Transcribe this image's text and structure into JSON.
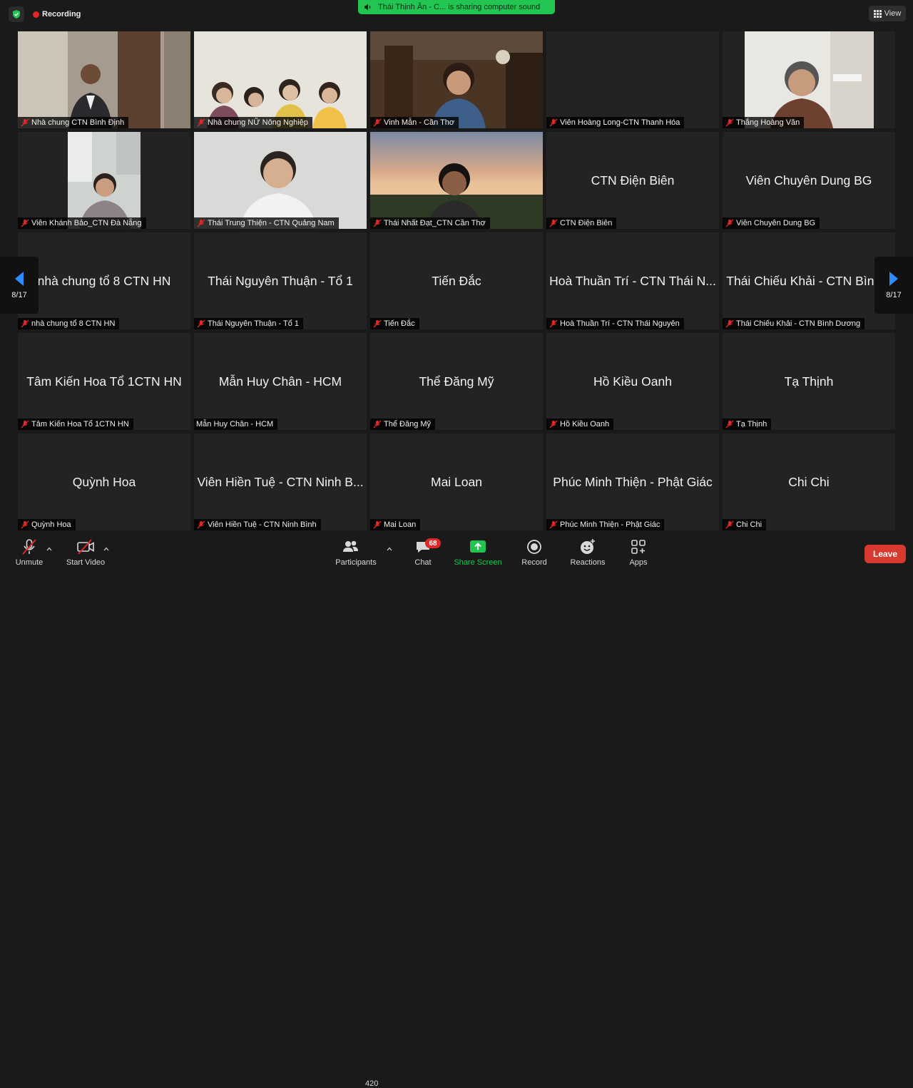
{
  "top": {
    "recording_label": "Recording",
    "share_banner": "Thái Thịnh Ân - C... is sharing computer sound",
    "view_label": "View"
  },
  "pager": {
    "left_text": "8/17",
    "right_text": "8/17"
  },
  "tiles": [
    {
      "name": "Nhà chung CTN Bình Định",
      "big": ""
    },
    {
      "name": "Nhà chung NỮ Nông Nghiệp",
      "big": ""
    },
    {
      "name": "Vinh Mẫn - Cần Thơ",
      "big": ""
    },
    {
      "name": "Viên Hoàng Long-CTN Thanh Hóa",
      "big": ""
    },
    {
      "name": "Thắng Hoàng Văn",
      "big": ""
    },
    {
      "name": "Viên Khánh Bảo_CTN Đà Nẵng",
      "big": ""
    },
    {
      "name": "Thái Trung Thiện - CTN Quảng Nam",
      "big": ""
    },
    {
      "name": "Thái Nhất Đạt_CTN Cần Thơ",
      "big": ""
    },
    {
      "name": "CTN Điện Biên",
      "big": "CTN Điện Biên"
    },
    {
      "name": "Viên Chuyên Dung BG",
      "big": "Viên Chuyên Dung BG"
    },
    {
      "name": "nhà chung tổ 8 CTN HN",
      "big": "nhà chung tổ 8 CTN HN"
    },
    {
      "name": "Thái Nguyên Thuận - Tổ 1",
      "big": "Thái Nguyên Thuận - Tổ 1"
    },
    {
      "name": "Tiến Đắc",
      "big": "Tiến Đắc"
    },
    {
      "name": "Hoà Thuần Trí - CTN Thái Nguyên",
      "big": "Hoà Thuần Trí - CTN Thái N..."
    },
    {
      "name": "Thái Chiếu Khải - CTN Bình Dương",
      "big": "Thái Chiếu Khải - CTN Bình..."
    },
    {
      "name": "Tâm Kiến Hoa Tổ 1CTN HN",
      "big": "Tâm Kiến Hoa Tổ 1CTN HN"
    },
    {
      "name": "Mẫn Huy Chân - HCM",
      "big": "Mẫn Huy Chân - HCM"
    },
    {
      "name": "Thể Đăng Mỹ",
      "big": "Thể Đăng Mỹ"
    },
    {
      "name": "Hồ Kiều Oanh",
      "big": "Hồ Kiều Oanh"
    },
    {
      "name": "Tạ Thịnh",
      "big": "Tạ Thịnh"
    },
    {
      "name": "Quỳnh Hoa",
      "big": "Quỳnh Hoa"
    },
    {
      "name": "Viên Hiền Tuệ - CTN Ninh Bình",
      "big": "Viên Hiền Tuệ - CTN Ninh B..."
    },
    {
      "name": "Mai Loan",
      "big": "Mai Loan"
    },
    {
      "name": "Phúc Minh Thiện - Phật Giác",
      "big": "Phúc Minh Thiện - Phật Giác"
    },
    {
      "name": "Chi Chi",
      "big": "Chi Chi"
    }
  ],
  "toolbar": {
    "unmute": "Unmute",
    "start_video": "Start Video",
    "participants": "Participants",
    "participants_count": "420",
    "chat": "Chat",
    "chat_badge": "68",
    "share_screen": "Share Screen",
    "record": "Record",
    "reactions": "Reactions",
    "apps": "Apps",
    "leave": "Leave"
  },
  "colors": {
    "share_green": "#23c552",
    "leave_red": "#d93a30",
    "mic_red": "#e02828"
  }
}
